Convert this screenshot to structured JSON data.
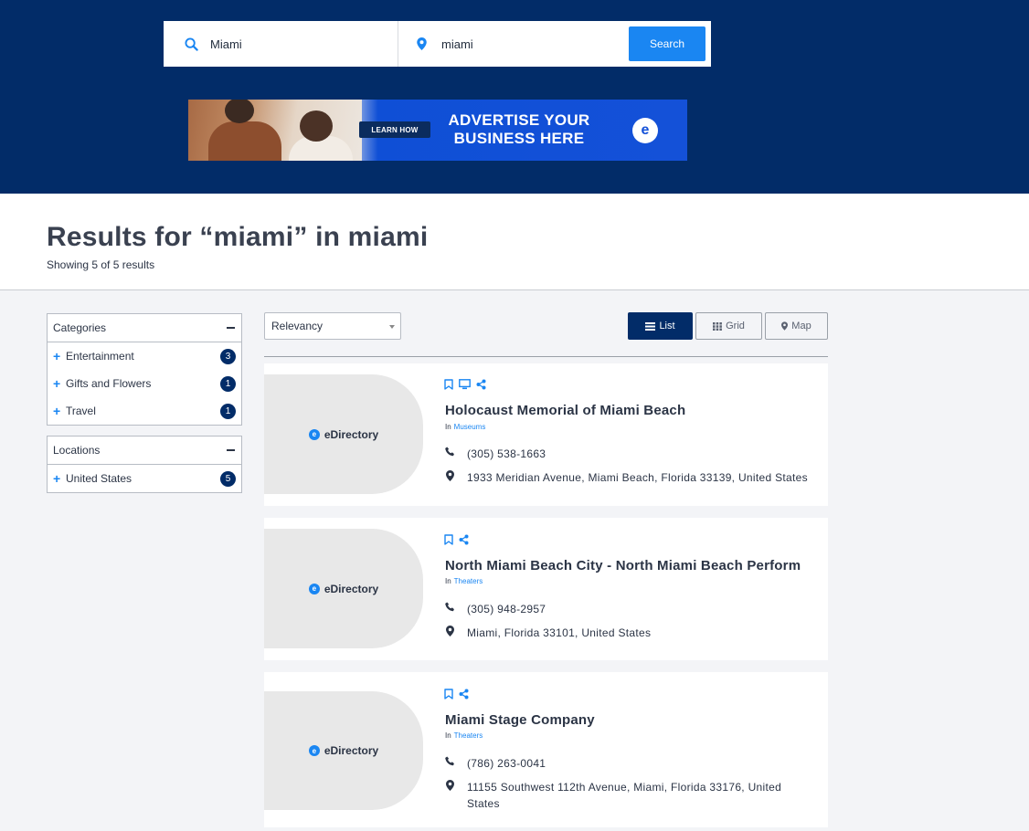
{
  "search": {
    "query_value": "Miami",
    "location_value": "miami",
    "button_label": "Search"
  },
  "banner": {
    "cta": "LEARN HOW",
    "headline_line1": "ADVERTISE YOUR",
    "headline_line2": "BUSINESS HERE",
    "logo_letter": "e"
  },
  "results": {
    "title": "Results for “miami” in miami",
    "count_text": "Showing 5 of 5 results"
  },
  "filters": {
    "categories": {
      "title": "Categories",
      "items": [
        {
          "label": "Entertainment",
          "count": "3"
        },
        {
          "label": "Gifts and Flowers",
          "count": "1"
        },
        {
          "label": "Travel",
          "count": "1"
        }
      ]
    },
    "locations": {
      "title": "Locations",
      "items": [
        {
          "label": "United States",
          "count": "5"
        }
      ]
    }
  },
  "toolbar": {
    "sort_value": "Relevancy",
    "view_list": "List",
    "view_grid": "Grid",
    "view_map": "Map"
  },
  "listings": [
    {
      "logo_text": "eDirectory",
      "name": "Holocaust Memorial of Miami Beach",
      "in_label": "In",
      "category": "Museums",
      "phone": "(305) 538-1663",
      "address": "1933 Meridian Avenue, Miami Beach, Florida 33139, United States"
    },
    {
      "logo_text": "eDirectory",
      "name": "North Miami Beach City - North Miami Beach Perform",
      "in_label": "In",
      "category": "Theaters",
      "phone": "(305) 948-2957",
      "address": "Miami, Florida 33101, United States"
    },
    {
      "logo_text": "eDirectory",
      "name": "Miami Stage Company",
      "in_label": "In",
      "category": "Theaters",
      "phone": "(786) 263-0041",
      "address": "11155 Southwest 112th Avenue, Miami, Florida 33176, United States"
    }
  ],
  "colors": {
    "hero_bg": "#022c68",
    "accent": "#1a86f2",
    "badge_bg": "#022c68"
  }
}
